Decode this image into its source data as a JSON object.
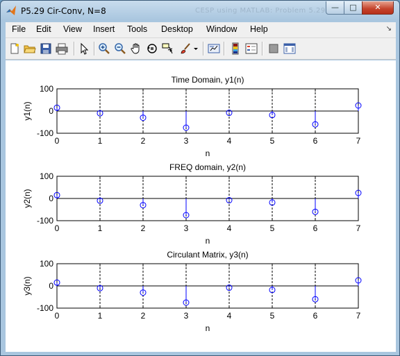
{
  "window": {
    "title": "P5.29 Cir-Conv, N=8",
    "ghost_title": "CESP using MATLAB: Problem 5.29",
    "controls": {
      "minimize": "—",
      "maximize": "□",
      "close": "✕"
    }
  },
  "menu": {
    "items": [
      "File",
      "Edit",
      "View",
      "Insert",
      "Tools",
      "Desktop",
      "Window",
      "Help"
    ],
    "dock_arrow": "↘"
  },
  "toolbar": {
    "icons": [
      "new-figure-icon",
      "open-file-icon",
      "save-icon",
      "print-icon",
      "pointer-icon",
      "zoom-in-icon",
      "zoom-out-icon",
      "pan-hand-icon",
      "rotate-3d-icon",
      "data-cursor-icon",
      "brush-icon",
      "brush-dropdown-icon",
      "link-plot-icon",
      "colorbar-icon",
      "legend-icon",
      "hide-plot-tools-icon",
      "show-plot-tools-icon"
    ]
  },
  "colors": {
    "stem": "#0000ff",
    "axes": "#000000",
    "grid": "#000000"
  },
  "chart_data": [
    {
      "type": "scatter",
      "style": "stem",
      "title": "Time Domain, y1(n)",
      "xlabel": "n",
      "ylabel": "y1(n)",
      "x": [
        0,
        1,
        2,
        3,
        4,
        5,
        6,
        7
      ],
      "values": [
        15,
        -10,
        -30,
        -75,
        -8,
        -18,
        -60,
        25
      ],
      "xlim": [
        0,
        7
      ],
      "ylim": [
        -100,
        100
      ],
      "xticks": [
        "0",
        "1",
        "2",
        "3",
        "4",
        "5",
        "6",
        "7"
      ],
      "yticks": [
        "100",
        "0",
        "-100"
      ],
      "grid": "vertical dashed lines at x ticks"
    },
    {
      "type": "scatter",
      "style": "stem",
      "title": "FREQ domain, y2(n)",
      "xlabel": "n",
      "ylabel": "y2(n)",
      "x": [
        0,
        1,
        2,
        3,
        4,
        5,
        6,
        7
      ],
      "values": [
        15,
        -10,
        -30,
        -75,
        -8,
        -18,
        -60,
        25
      ],
      "xlim": [
        0,
        7
      ],
      "ylim": [
        -100,
        100
      ],
      "xticks": [
        "0",
        "1",
        "2",
        "3",
        "4",
        "5",
        "6",
        "7"
      ],
      "yticks": [
        "100",
        "0",
        "-100"
      ],
      "grid": "vertical dashed lines at x ticks"
    },
    {
      "type": "scatter",
      "style": "stem",
      "title": "Circulant Matrix, y3(n)",
      "xlabel": "n",
      "ylabel": "y3(n)",
      "x": [
        0,
        1,
        2,
        3,
        4,
        5,
        6,
        7
      ],
      "values": [
        15,
        -10,
        -30,
        -75,
        -8,
        -18,
        -60,
        25
      ],
      "xlim": [
        0,
        7
      ],
      "ylim": [
        -100,
        100
      ],
      "xticks": [
        "0",
        "1",
        "2",
        "3",
        "4",
        "5",
        "6",
        "7"
      ],
      "yticks": [
        "100",
        "0",
        "-100"
      ],
      "grid": "vertical dashed lines at x ticks"
    }
  ]
}
